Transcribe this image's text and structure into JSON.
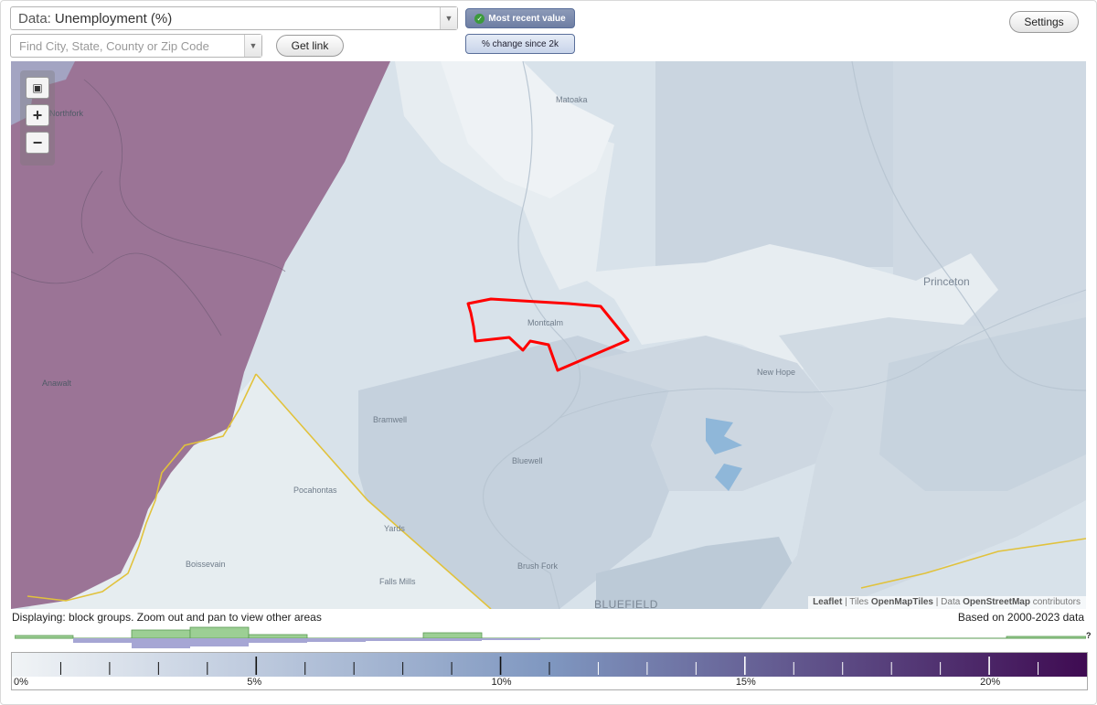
{
  "data_select": {
    "label": "Data:",
    "value": "Unemployment (%)"
  },
  "search": {
    "placeholder": "Find City, State, County or Zip Code"
  },
  "buttons": {
    "get_link": "Get link",
    "settings": "Settings"
  },
  "toggles": {
    "most_recent": "Most recent value",
    "change": "% change since 2k"
  },
  "map": {
    "places": {
      "matoaka": "Matoaka",
      "northfork": "Northfork",
      "princeton": "Princeton",
      "montcalm": "Montcalm",
      "anawalt": "Anawalt",
      "new_hope": "New Hope",
      "bramwell": "Bramwell",
      "bluewell": "Bluewell",
      "pocahontas": "Pocahontas",
      "yards": "Yards",
      "boissevain": "Boissevain",
      "falls_mills": "Falls Mills",
      "brush_fork": "Brush Fork",
      "bluefield": "BLUEFIELD"
    },
    "attribution": {
      "leaflet": "Leaflet",
      "tiles_prefix": "Tiles",
      "tiles": "OpenMapTiles",
      "data_prefix": "Data",
      "data": "OpenStreetMap",
      "suffix": "contributors"
    },
    "colors": {
      "high_area": "#9b7496",
      "selected_outline": "#ff0000",
      "state_border": "#e1c23c"
    }
  },
  "status": {
    "displaying": "Displaying: block groups. Zoom out and pan to view other areas",
    "based_on": "Based on 2000-2023 data"
  },
  "histogram": {
    "unknown_label": "?",
    "colors": {
      "green": "#9ccf94",
      "purple": "#a6a6d4"
    }
  },
  "legend": {
    "min": 0,
    "max": 22,
    "labels": [
      "0%",
      "5%",
      "10%",
      "15%",
      "20%"
    ],
    "label_values": [
      0,
      5,
      10,
      15,
      20
    ],
    "color_start": "#f1f4f6",
    "color_mid": "#7f97c0",
    "color_end": "#3f0b52"
  }
}
